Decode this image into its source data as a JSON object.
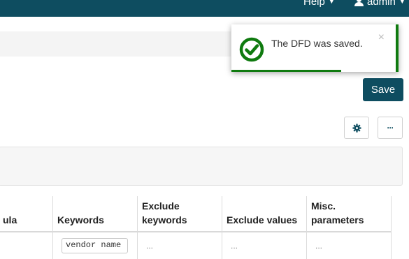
{
  "nav": {
    "help_label": "Help",
    "admin_label": "admin",
    "caret": "▼"
  },
  "toast": {
    "message": "The DFD was saved.",
    "close_glyph": "×",
    "progress_fraction": 0.67,
    "accent_color": "#0f7a0f"
  },
  "actions": {
    "save_label": "Save",
    "settings_icon": "gear-icon",
    "more_label": "···"
  },
  "table": {
    "columns": [
      {
        "label": "ula"
      },
      {
        "label": "Keywords"
      },
      {
        "label": "Exclude keywords"
      },
      {
        "label": "Exclude values"
      },
      {
        "label": "Misc. parameters"
      }
    ],
    "row": {
      "keywords_value": "vendor name",
      "exclude_keywords": "...",
      "exclude_values": "...",
      "misc_parameters": "..."
    }
  },
  "colors": {
    "brand": "#0e4d60",
    "success": "#0f7a0f"
  }
}
